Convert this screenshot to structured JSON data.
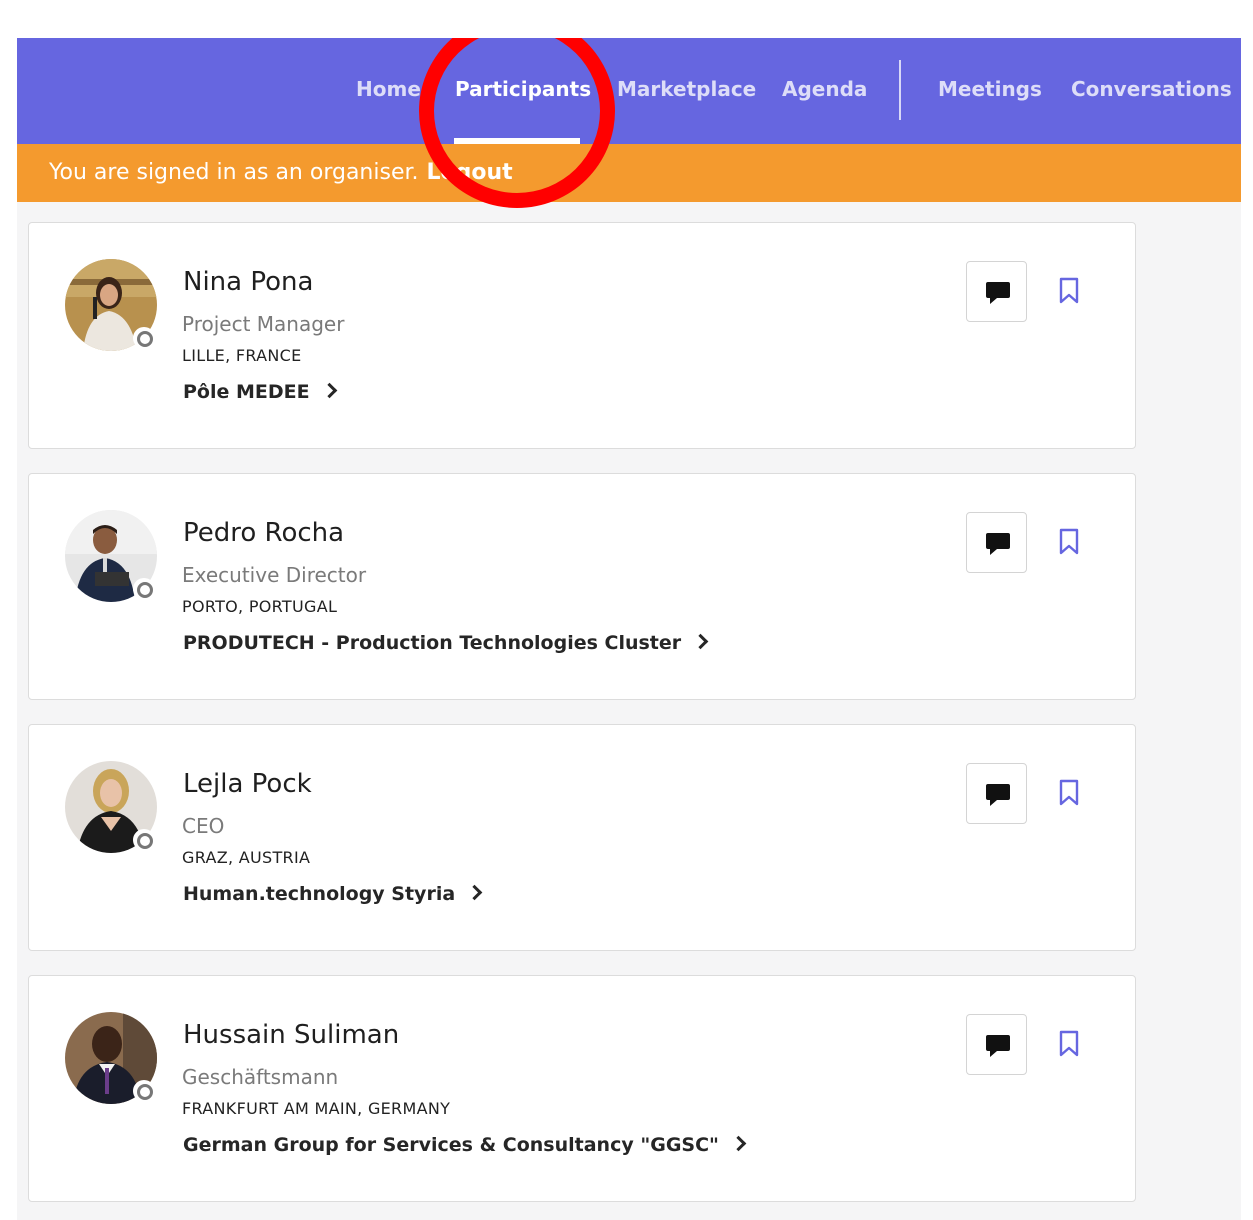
{
  "nav": {
    "items": [
      {
        "label": "Home",
        "active": false
      },
      {
        "label": "Participants",
        "active": true
      },
      {
        "label": "Marketplace",
        "active": false
      },
      {
        "label": "Agenda",
        "active": false
      },
      {
        "label": "Meetings",
        "active": false
      },
      {
        "label": "Conversations",
        "active": false
      }
    ],
    "color": "#6666e0"
  },
  "banner": {
    "text": "You are signed in as an organiser.",
    "logout_label": "Logout",
    "color": "#f49a2e"
  },
  "participants": [
    {
      "name": "Nina Pona",
      "role": "Project Manager",
      "location": "LILLE, FRANCE",
      "organization": "Pôle MEDEE",
      "status": "offline"
    },
    {
      "name": "Pedro Rocha",
      "role": "Executive Director",
      "location": "PORTO, PORTUGAL",
      "organization": "PRODUTECH - Production Technologies Cluster",
      "status": "offline"
    },
    {
      "name": "Lejla Pock",
      "role": "CEO",
      "location": "GRAZ, AUSTRIA",
      "organization": "Human.technology Styria",
      "status": "offline"
    },
    {
      "name": "Hussain Suliman",
      "role": "Geschäftsmann",
      "location": "FRANKFURT AM MAIN, GERMANY",
      "organization": "German Group for Services & Consultancy \"GGSC\"",
      "status": "offline"
    }
  ],
  "icons": {
    "chat": "chat-bubble-icon",
    "bookmark": "bookmark-icon",
    "chevron": "chevron-right-icon",
    "status": "status-ring-icon"
  },
  "annotation_color": "#ff0000"
}
